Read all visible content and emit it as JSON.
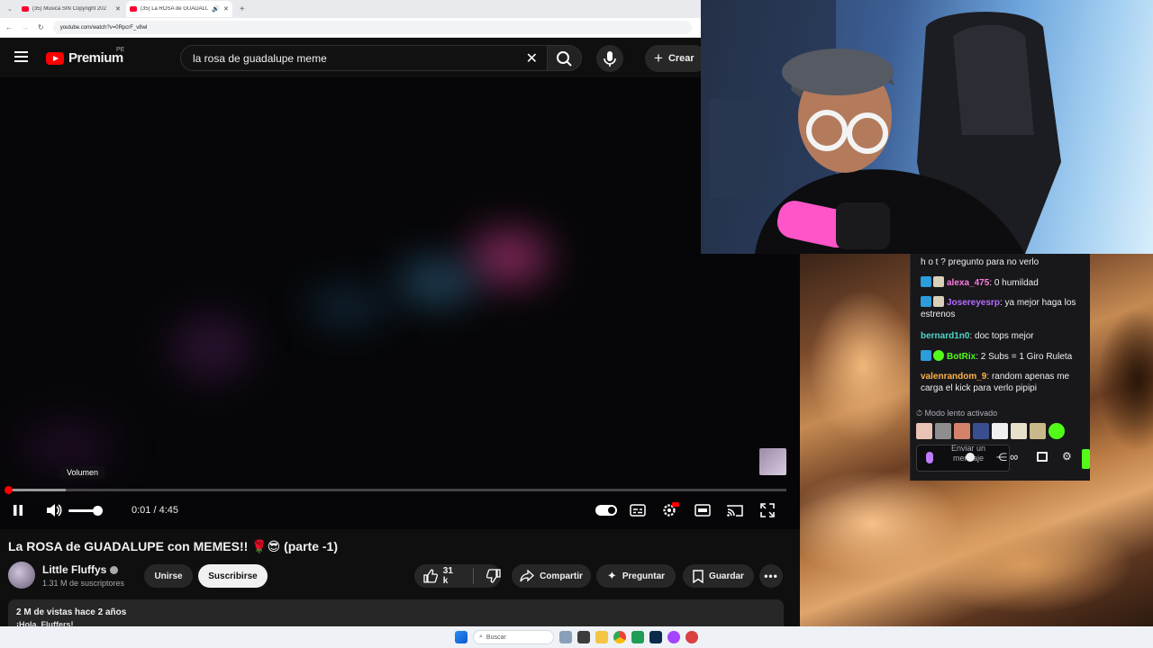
{
  "browser": {
    "tabs": [
      {
        "title": "(35) Música SIN Copyright 202",
        "active": false
      },
      {
        "title": "(35) La ROSA de GUADALUP",
        "active": true
      }
    ],
    "new_tab": "+",
    "url": "youtube.com/watch?v=0RpcrF_v8wI"
  },
  "youtube": {
    "logo_text": "Premium",
    "country_code": "PE",
    "search_query": "la rosa de guadalupe meme",
    "create_label": "Crear"
  },
  "player": {
    "volume_tooltip": "Volumen",
    "time": "0:01 / 4:45",
    "progress_fraction": 0.001,
    "buffered_fraction": 0.075,
    "volume_fraction": 0.9
  },
  "video": {
    "title": "La ROSA de GUADALUPE con MEMES!! 🌹😎 (parte -1)",
    "channel": "Little Fluffys",
    "subscribers": "1.31 M de suscriptores",
    "join_label": "Unirse",
    "subscribe_label": "Suscribirse",
    "likes": "31 k",
    "share_label": "Compartir",
    "ask_label": "Preguntar",
    "save_label": "Guardar",
    "views_line": "2 M de vistas  hace 2 años",
    "description_start": "¡Hola, Fluffers!"
  },
  "chat": {
    "messages": [
      {
        "user": "",
        "text": "h o t ? pregunto para no verlo",
        "color": "#efeff1"
      },
      {
        "user": "alexa_475",
        "text": "0 humildad",
        "color": "#ff7ae0"
      },
      {
        "user": "Josereyesrp",
        "text": "ya mejor haga los estrenos",
        "color": "#b56bff"
      },
      {
        "user": "bernard1n0",
        "text": "doc tops mejor",
        "color": "#4fd6c7"
      },
      {
        "user": "BotRix",
        "text": "2 Subs = 1 Giro Ruleta",
        "color": "#53fc18"
      },
      {
        "user": "valenrandom_9",
        "text": "random apenas me carga el kick para verlo pipipi",
        "color": "#ffb347"
      }
    ],
    "slow_mode": "Modo lento activado",
    "input_placeholder": "Enviar un mensaje"
  },
  "taskbar": {
    "search_label": "Buscar"
  }
}
